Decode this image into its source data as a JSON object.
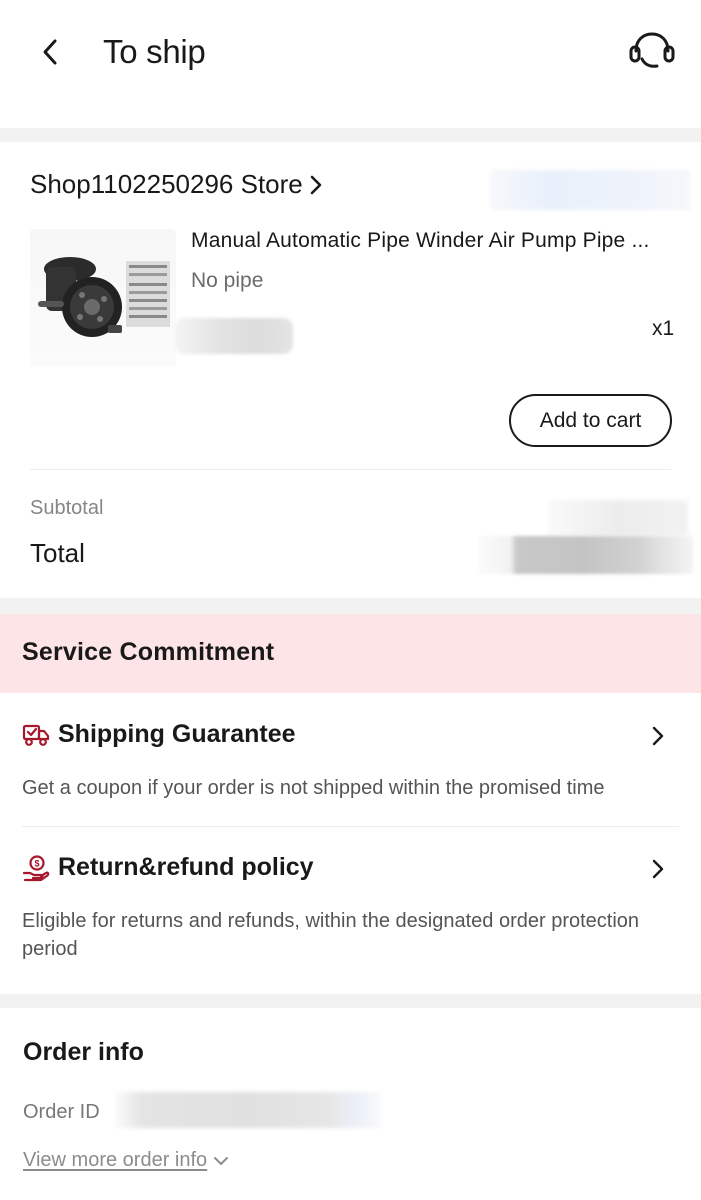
{
  "header": {
    "title": "To ship",
    "back_icon": "chevron-left-icon",
    "support_icon": "headset-icon"
  },
  "order": {
    "store_name": "Shop1102250296 Store",
    "product": {
      "title": "Manual Automatic Pipe Winder Air Pump Pipe ...",
      "variant": "No pipe",
      "quantity": "x1"
    },
    "add_to_cart_label": "Add to cart",
    "subtotal_label": "Subtotal",
    "total_label": "Total"
  },
  "service": {
    "title": "Service Commitment",
    "items": [
      {
        "icon": "delivery-truck-icon",
        "title": "Shipping Guarantee",
        "desc": "Get a coupon if your order is not shipped within the promised time"
      },
      {
        "icon": "refund-hand-icon",
        "title": "Return&refund policy",
        "desc": "Eligible for returns and refunds, within the designated order protection period"
      }
    ]
  },
  "order_info": {
    "title": "Order info",
    "order_id_label": "Order ID",
    "view_more_label": "View more order info"
  },
  "colors": {
    "service_header_bg": "#fde4e6",
    "icon_accent": "#a8182d",
    "text_primary": "#191919",
    "text_secondary": "#858585"
  }
}
